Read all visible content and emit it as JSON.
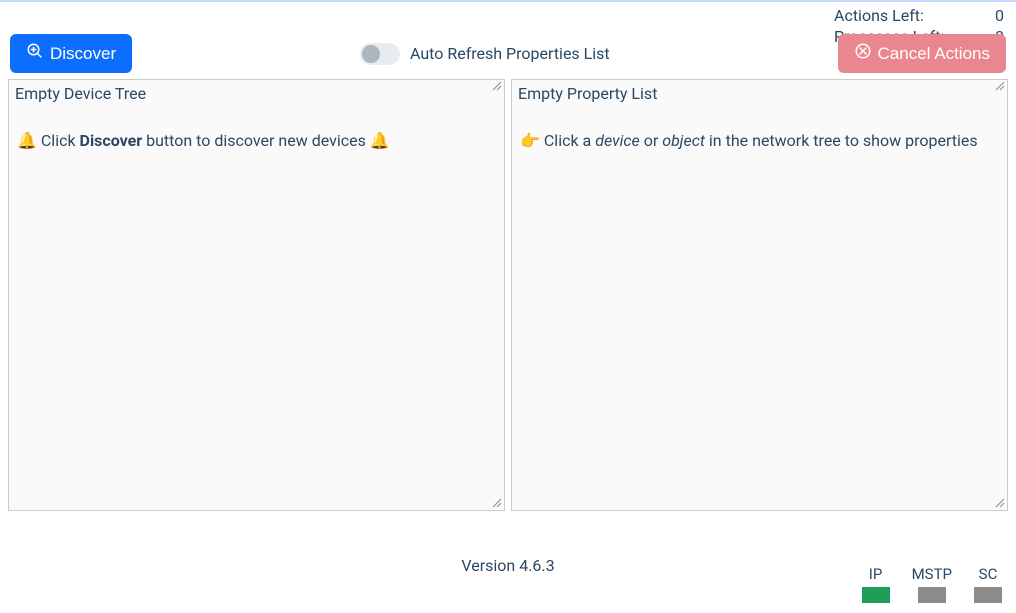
{
  "status": {
    "actions_left_label": "Actions Left:",
    "actions_left_value": "0",
    "processes_left_label": "Processes Left:",
    "processes_left_value": "0"
  },
  "toolbar": {
    "discover_label": "Discover",
    "auto_refresh_label": "Auto Refresh Properties List",
    "auto_refresh_on": false,
    "cancel_actions_label": "Cancel Actions"
  },
  "panels": {
    "device_tree": {
      "title": "Empty Device Tree",
      "hint_prefix": "Click ",
      "hint_bold": "Discover",
      "hint_suffix": " button to discover new devices "
    },
    "property_list": {
      "title": "Empty Property List",
      "hint_prefix": "Click a ",
      "hint_italic1": "device",
      "hint_mid": " or ",
      "hint_italic2": "object",
      "hint_suffix": " in the network tree to show properties"
    }
  },
  "footer": {
    "version_label": "Version 4.6.3",
    "legend": [
      {
        "label": "IP",
        "color": "#1f9e58"
      },
      {
        "label": "MSTP",
        "color": "#8c8c8c"
      },
      {
        "label": "SC",
        "color": "#8c8c8c"
      }
    ]
  },
  "colors": {
    "primary": "#0d6efd",
    "danger": "#ea868f"
  }
}
